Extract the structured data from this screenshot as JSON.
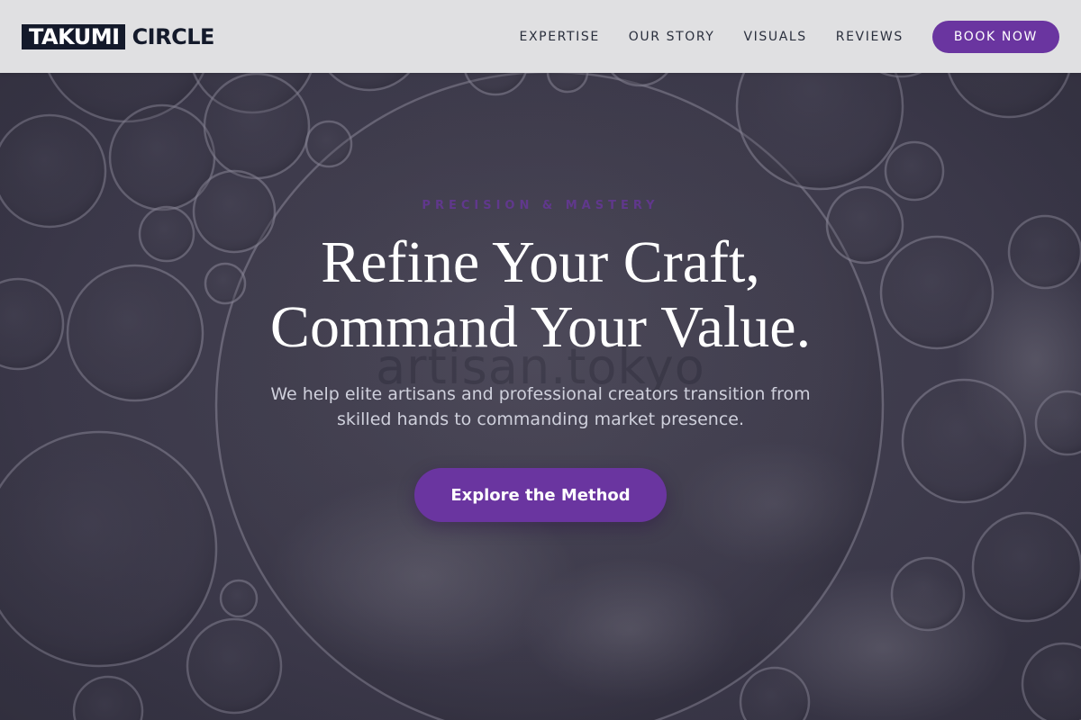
{
  "header": {
    "logo": {
      "highlight": "TAKUMI",
      "rest": "CIRCLE"
    },
    "nav": [
      {
        "label": "EXPERTISE"
      },
      {
        "label": "OUR STORY"
      },
      {
        "label": "VISUALS"
      },
      {
        "label": "REVIEWS"
      }
    ],
    "book_button": "BOOK NOW"
  },
  "hero": {
    "eyebrow": "PRECISION & MASTERY",
    "headline_line1": "Refine Your Craft,",
    "headline_line2": "Command Your Value.",
    "watermark": "artisan.tokyo",
    "subtext": "We help elite artisans and professional creators transition from skilled hands to commanding market presence.",
    "cta_label": "Explore the Method",
    "background_image": "bubbles-icon"
  },
  "colors": {
    "accent": "#6a35a0",
    "header_bg": "#e0e0e2",
    "logo_dark": "#141a2b",
    "hero_text": "#ffffff",
    "hero_subtext": "#cfd0dc"
  }
}
